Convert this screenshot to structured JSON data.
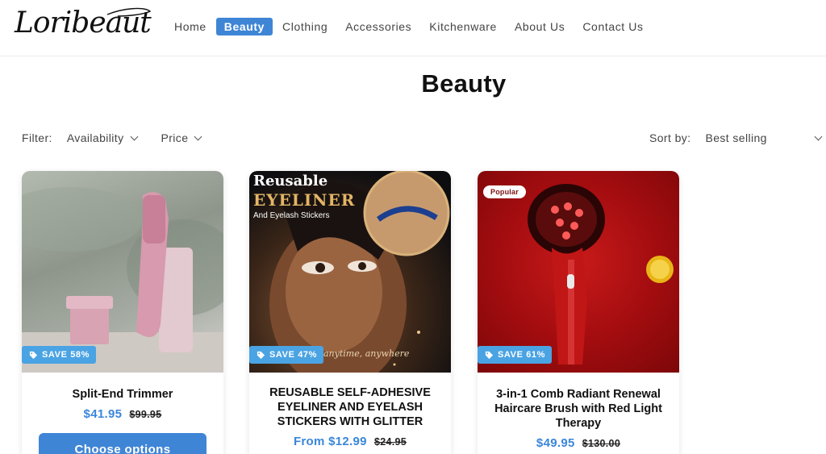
{
  "brand": {
    "logo_text": "Loribeaut"
  },
  "nav": {
    "items": [
      {
        "label": "Home"
      },
      {
        "label": "Beauty"
      },
      {
        "label": "Clothing"
      },
      {
        "label": "Accessories"
      },
      {
        "label": "Kitchenware"
      },
      {
        "label": "About Us"
      },
      {
        "label": "Contact Us"
      }
    ],
    "active": "Beauty"
  },
  "page": {
    "title": "Beauty"
  },
  "filters": {
    "label": "Filter:",
    "availability": "Availability",
    "price": "Price"
  },
  "sort": {
    "label": "Sort by:",
    "selected": "Best selling"
  },
  "products": [
    {
      "title": "Split-End Trimmer",
      "price": "$41.95",
      "compare_price": "$99.95",
      "badge": "SAVE 58%",
      "button": "Choose options"
    },
    {
      "title": "REUSABLE SELF-ADHESIVE EYELINER AND EYELASH STICKERS WITH GLITTER",
      "price": "From $12.99",
      "compare_price": "$24.95",
      "badge": "SAVE 47%",
      "image_text": {
        "line1": "Reusable",
        "line2": "EYELINER",
        "line3": "And Eyelash Stickers",
        "tagline": "anytime, anywhere"
      }
    },
    {
      "title": "3-in-1 Comb Radiant Renewal Haircare Brush with Red Light Therapy",
      "price": "$49.95",
      "compare_price": "$130.00",
      "badge": "SAVE 61%",
      "pill": "Popular"
    }
  ],
  "colors": {
    "accent": "#3f85d6",
    "badge": "#4aa3e3",
    "price": "#3a86d9"
  }
}
